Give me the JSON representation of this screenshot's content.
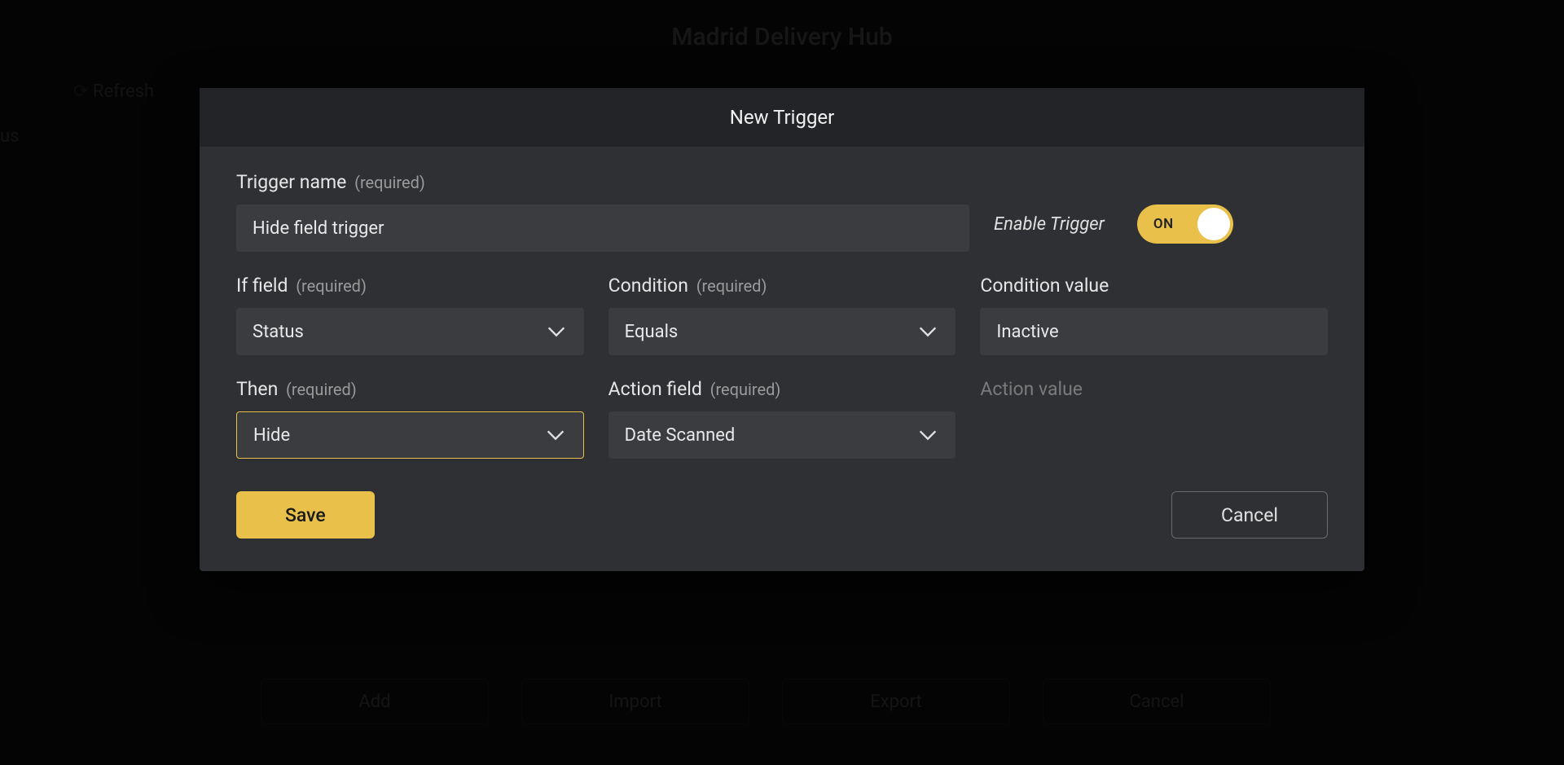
{
  "background": {
    "title": "Madrid Delivery Hub",
    "toolbar": {
      "refresh": "Refresh"
    },
    "status_label": "us",
    "bottom_buttons": {
      "add": "Add",
      "import": "Import",
      "export": "Export",
      "cancel": "Cancel"
    }
  },
  "modal": {
    "title": "New Trigger",
    "trigger_name": {
      "label": "Trigger name",
      "required": "(required)",
      "value": "Hide field trigger"
    },
    "enable": {
      "label": "Enable Trigger",
      "state": "ON"
    },
    "if_field": {
      "label": "If field",
      "required": "(required)",
      "value": "Status"
    },
    "condition": {
      "label": "Condition",
      "required": "(required)",
      "value": "Equals"
    },
    "condition_value": {
      "label": "Condition value",
      "value": "Inactive"
    },
    "then": {
      "label": "Then",
      "required": "(required)",
      "value": "Hide"
    },
    "action_field": {
      "label": "Action field",
      "required": "(required)",
      "value": "Date Scanned"
    },
    "action_value": {
      "label": "Action value",
      "value": ""
    },
    "buttons": {
      "save": "Save",
      "cancel": "Cancel"
    }
  }
}
